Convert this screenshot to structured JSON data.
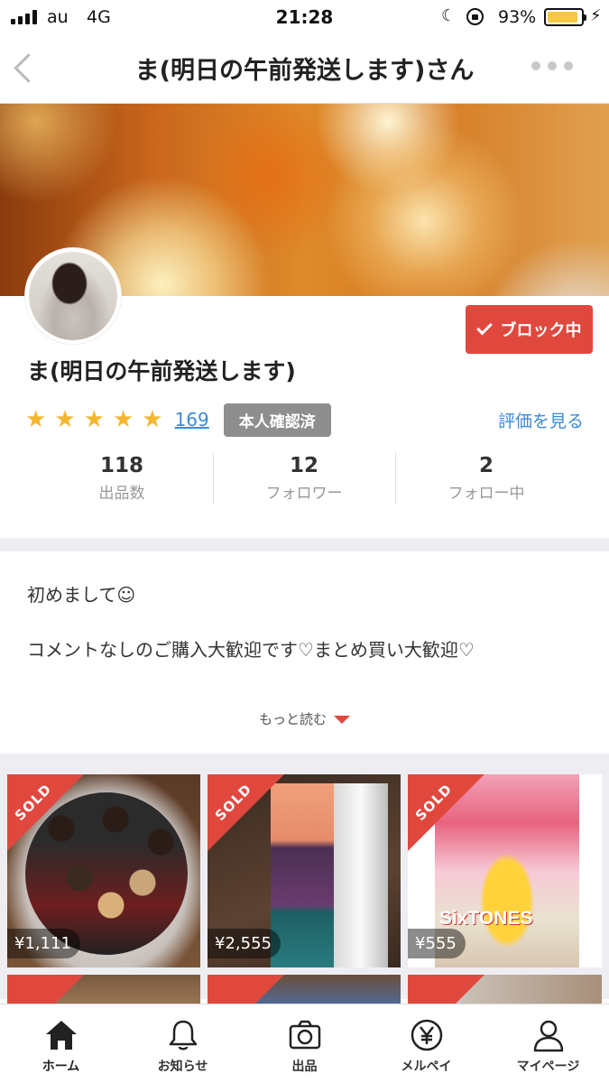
{
  "status_bar": {
    "carrier": "au",
    "network": "4G",
    "time": "21:28",
    "battery_percent": "93%",
    "battery_level": 0.93,
    "battery_color": "#f7c843"
  },
  "nav": {
    "title": "ま(明日の午前発送します)さん",
    "back_icon": "chevron-left-icon",
    "more_icon": "more-dots-icon"
  },
  "profile": {
    "name": "ま(明日の午前発送します)",
    "block_label": "ブロック中",
    "block_color": "#e0483e",
    "stars": 5,
    "rating_count": "169",
    "verified_badge": "本人確認済",
    "view_reviews": "評価を見る",
    "stats": [
      {
        "value": "118",
        "label": "出品数"
      },
      {
        "value": "12",
        "label": "フォロワー"
      },
      {
        "value": "2",
        "label": "フォロー中"
      }
    ]
  },
  "bio": {
    "line1": "初めまして☺︎",
    "line2": "コメントなしのご購入大歓迎です♡まとめ買い大歓迎♡",
    "read_more": "もっと読む"
  },
  "items": [
    {
      "status": "SOLD",
      "price": "¥1,111"
    },
    {
      "status": "SOLD",
      "price": "¥2,555"
    },
    {
      "status": "SOLD",
      "price": "¥555",
      "cover_title": "SixTONES"
    }
  ],
  "tabs": [
    {
      "label": "ホーム",
      "icon": "home-icon"
    },
    {
      "label": "お知らせ",
      "icon": "bell-icon"
    },
    {
      "label": "出品",
      "icon": "camera-icon"
    },
    {
      "label": "メルペイ",
      "icon": "yen-icon"
    },
    {
      "label": "マイページ",
      "icon": "person-icon"
    }
  ]
}
